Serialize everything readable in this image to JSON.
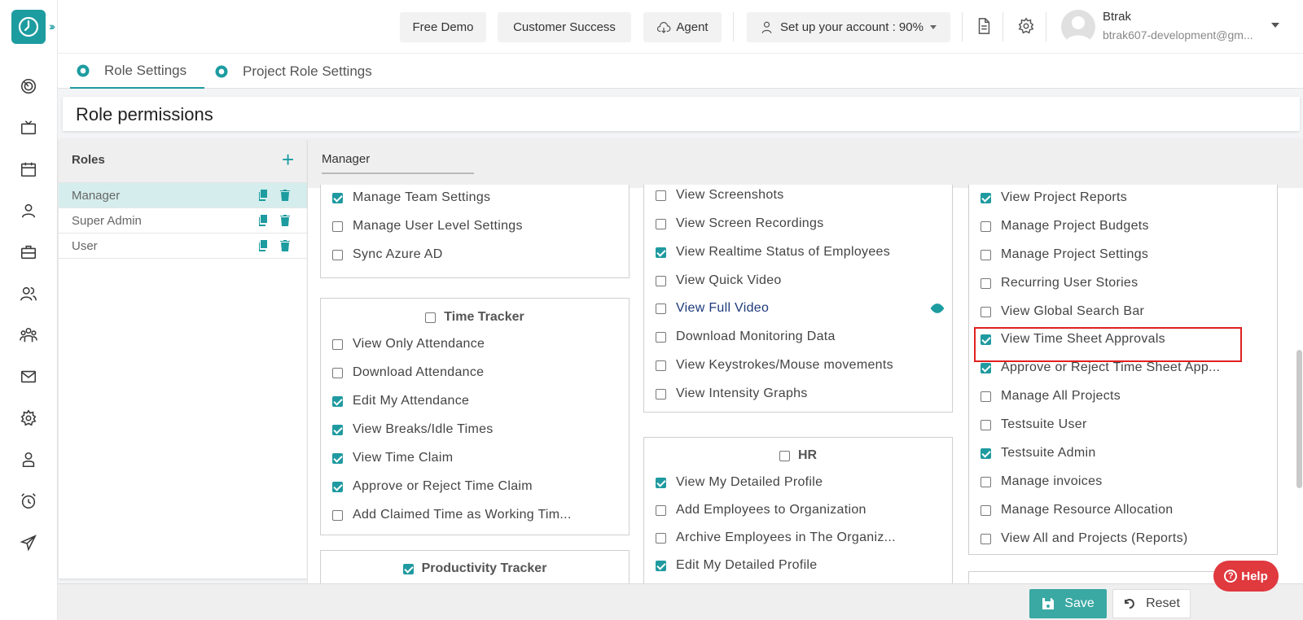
{
  "header": {
    "free_demo": "Free Demo",
    "customer_success": "Customer Success",
    "agent": "Agent",
    "setup": "Set up your account : 90%",
    "user_name": "Btrak",
    "user_email": "btrak607-development@gm..."
  },
  "tabs": [
    {
      "label": "Role Settings"
    },
    {
      "label": "Project Role Settings"
    }
  ],
  "page_title": "Role permissions",
  "roles": {
    "title": "Roles",
    "items": [
      {
        "name": "Manager"
      },
      {
        "name": "Super Admin"
      },
      {
        "name": "User"
      }
    ]
  },
  "selected_role": "Manager",
  "col1": {
    "top_items": [
      {
        "label": "Manage Team Settings",
        "checked": true
      },
      {
        "label": "Manage User Level Settings",
        "checked": false
      },
      {
        "label": "Sync Azure AD",
        "checked": false
      }
    ],
    "time_tracker": {
      "title": "Time Tracker",
      "checked": false,
      "items": [
        {
          "label": "View Only Attendance",
          "checked": false
        },
        {
          "label": "Download Attendance",
          "checked": false
        },
        {
          "label": "Edit My Attendance",
          "checked": true
        },
        {
          "label": "View Breaks/Idle Times",
          "checked": true
        },
        {
          "label": "View Time Claim",
          "checked": true
        },
        {
          "label": "Approve or Reject Time Claim",
          "checked": true
        },
        {
          "label": "Add Claimed Time as Working Tim...",
          "checked": false
        }
      ]
    },
    "productivity_tracker": {
      "title": "Productivity Tracker",
      "checked": true
    }
  },
  "col2": {
    "top_items": [
      {
        "label": "View Screenshots",
        "checked": false
      },
      {
        "label": "View Screen Recordings",
        "checked": false
      },
      {
        "label": "View Realtime Status of Employees",
        "checked": true
      },
      {
        "label": "View Quick Video",
        "checked": false
      },
      {
        "label": "View Full Video",
        "checked": false
      },
      {
        "label": "Download Monitoring Data",
        "checked": false
      },
      {
        "label": "View Keystrokes/Mouse movements",
        "checked": false
      },
      {
        "label": "View Intensity Graphs",
        "checked": false
      }
    ],
    "hr": {
      "title": "HR",
      "checked": false,
      "items": [
        {
          "label": "View My Detailed Profile",
          "checked": true
        },
        {
          "label": "Add Employees to Organization",
          "checked": false
        },
        {
          "label": "Archive Employees in The Organiz...",
          "checked": false
        },
        {
          "label": "Edit My Detailed Profile",
          "checked": true
        }
      ]
    }
  },
  "col3": {
    "items": [
      {
        "label": "View Project Reports",
        "checked": true
      },
      {
        "label": "Manage Project Budgets",
        "checked": false
      },
      {
        "label": "Manage Project Settings",
        "checked": false
      },
      {
        "label": "Recurring User Stories",
        "checked": false
      },
      {
        "label": "View Global Search Bar",
        "checked": false
      },
      {
        "label": "View Time Sheet Approvals",
        "checked": true
      },
      {
        "label": "Approve or Reject Time Sheet App...",
        "checked": true
      },
      {
        "label": "Manage All Projects",
        "checked": false
      },
      {
        "label": "Testsuite User",
        "checked": false
      },
      {
        "label": "Testsuite Admin",
        "checked": true
      },
      {
        "label": "Manage invoices",
        "checked": false
      },
      {
        "label": "Manage Resource Allocation",
        "checked": false
      },
      {
        "label": "View All and Projects (Reports)",
        "checked": false
      }
    ]
  },
  "footer": {
    "save": "Save",
    "reset": "Reset"
  },
  "help": "Help",
  "colors": {
    "accent": "#1d9ca0",
    "highlight": "#e02020",
    "help": "#e0393e"
  }
}
